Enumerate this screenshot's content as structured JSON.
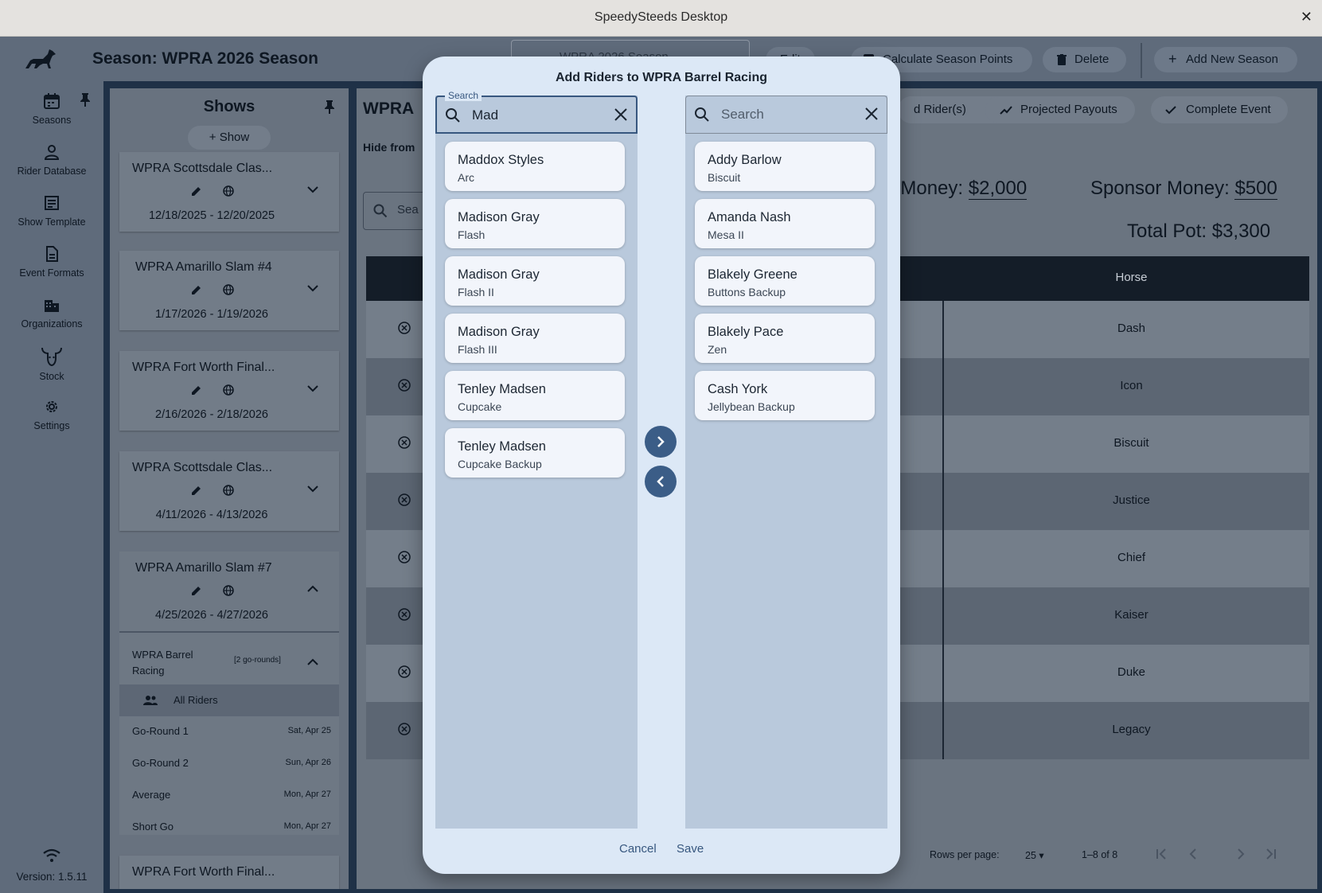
{
  "window": {
    "title": "SpeedySteeds Desktop",
    "close": "✕"
  },
  "header": {
    "season_title": "Season: WPRA 2026 Season",
    "season_select": "WPRA 2026 Season",
    "edit_label": "Edit",
    "calc_label": "Calculate Season Points",
    "delete_label": "Delete",
    "add_season_label": "Add New Season"
  },
  "nav": {
    "items": [
      {
        "label": "Seasons",
        "icon": "calendar-icon"
      },
      {
        "label": "Rider Database",
        "icon": "person-icon"
      },
      {
        "label": "Show Template",
        "icon": "template-icon"
      },
      {
        "label": "Event Formats",
        "icon": "document-icon"
      },
      {
        "label": "Organizations",
        "icon": "building-icon"
      },
      {
        "label": "Stock",
        "icon": "bull-icon"
      },
      {
        "label": "Settings",
        "icon": "gear-icon"
      }
    ],
    "version": "Version: 1.5.11"
  },
  "shows": {
    "title": "Shows",
    "add_label": "Show",
    "cards": [
      {
        "name": "WPRA Scottsdale Clas...",
        "dates": "12/18/2025 - 12/20/2025"
      },
      {
        "name": "WPRA Amarillo Slam #4",
        "dates": "1/17/2026 - 1/19/2026"
      },
      {
        "name": "WPRA Fort Worth Final...",
        "dates": "2/16/2026 - 2/18/2026"
      },
      {
        "name": "WPRA Scottsdale Clas...",
        "dates": "4/11/2026 - 4/13/2026"
      },
      {
        "name": "WPRA Amarillo Slam #7",
        "dates": "4/25/2026 - 4/27/2026"
      },
      {
        "name": "WPRA Fort Worth Final...",
        "dates": ""
      }
    ],
    "event": {
      "name": "WPRA Barrel Racing",
      "rounds_badge": "[2 go-rounds]",
      "all_riders": "All Riders",
      "rounds": [
        {
          "label": "Go-Round 1",
          "date": "Sat, Apr 25"
        },
        {
          "label": "Go-Round 2",
          "date": "Sun, Apr 26"
        },
        {
          "label": "Average",
          "date": "Mon, Apr 27"
        },
        {
          "label": "Short Go",
          "date": "Mon, Apr 27"
        }
      ]
    }
  },
  "main": {
    "title": "WPRA",
    "hide_from": "Hide from",
    "search_placeholder": "Sea",
    "add_riders_label": "d Rider(s)",
    "projected_label": "Projected Payouts",
    "complete_label": "Complete Event",
    "added_money_label": "ed Money:",
    "added_money_currency": "$",
    "added_money_value": "2,000",
    "sponsor_money_label": "Sponsor Money:",
    "sponsor_money_currency": "$",
    "sponsor_money_value": "500",
    "total_pot": "Total Pot: $3,300",
    "horse_header": "Horse",
    "horses": [
      "Dash",
      "Icon",
      "Biscuit",
      "Justice",
      "Chief",
      "Kaiser",
      "Duke",
      "Legacy"
    ],
    "rows_per_page_label": "Rows per page:",
    "rows_per_page_value": "25",
    "range_label": "1–8 of 8"
  },
  "dialog": {
    "title": "Add Riders to WPRA Barrel Racing",
    "left_search_label": "Search",
    "left_search_value": "Mad",
    "right_search_placeholder": "Search",
    "left_list": [
      {
        "rider": "Maddox Styles",
        "horse": "Arc"
      },
      {
        "rider": "Madison Gray",
        "horse": "Flash"
      },
      {
        "rider": "Madison Gray",
        "horse": "Flash II"
      },
      {
        "rider": "Madison Gray",
        "horse": "Flash III"
      },
      {
        "rider": "Tenley Madsen",
        "horse": "Cupcake"
      },
      {
        "rider": "Tenley Madsen",
        "horse": "Cupcake Backup"
      }
    ],
    "right_list": [
      {
        "rider": "Addy Barlow",
        "horse": "Biscuit"
      },
      {
        "rider": "Amanda Nash",
        "horse": "Mesa II"
      },
      {
        "rider": "Blakely Greene",
        "horse": "Buttons Backup"
      },
      {
        "rider": "Blakely Pace",
        "horse": "Zen"
      },
      {
        "rider": "Cash York",
        "horse": "Jellybean Backup"
      }
    ],
    "cancel_label": "Cancel",
    "save_label": "Save"
  },
  "colors": {
    "accent": "#3b5d87",
    "dialog_bg": "#dce8f6",
    "list_bg": "#b9c9dc",
    "table_header": "#141d28"
  }
}
